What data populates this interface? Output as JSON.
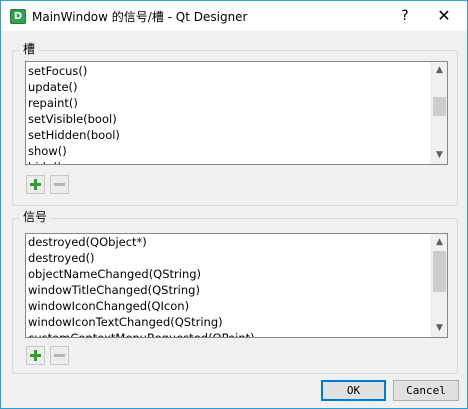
{
  "window": {
    "icon_letter": "D",
    "title": "MainWindow 的信号/槽 - Qt Designer",
    "help_label": "?",
    "close_label": "✕"
  },
  "slots": {
    "title": "槽",
    "items": [
      "setFocus()",
      "update()",
      "repaint()",
      "setVisible(bool)",
      "setHidden(bool)",
      "show()",
      "hide()"
    ]
  },
  "signals": {
    "title": "信号",
    "items": [
      "destroyed(QObject*)",
      "destroyed()",
      "objectNameChanged(QString)",
      "windowTitleChanged(QString)",
      "windowIconChanged(QIcon)",
      "windowIconTextChanged(QString)",
      "customContextMenuRequested(QPoint)"
    ]
  },
  "icons": {
    "add": "plus-icon",
    "remove": "minus-icon",
    "scroll_up": "chevron-up-icon",
    "scroll_down": "chevron-down-icon"
  },
  "colors": {
    "accent": "#0078d7",
    "add_green": "#29a329",
    "window_border": "#2a9fd6"
  },
  "buttons": {
    "ok": "OK",
    "cancel": "Cancel"
  }
}
